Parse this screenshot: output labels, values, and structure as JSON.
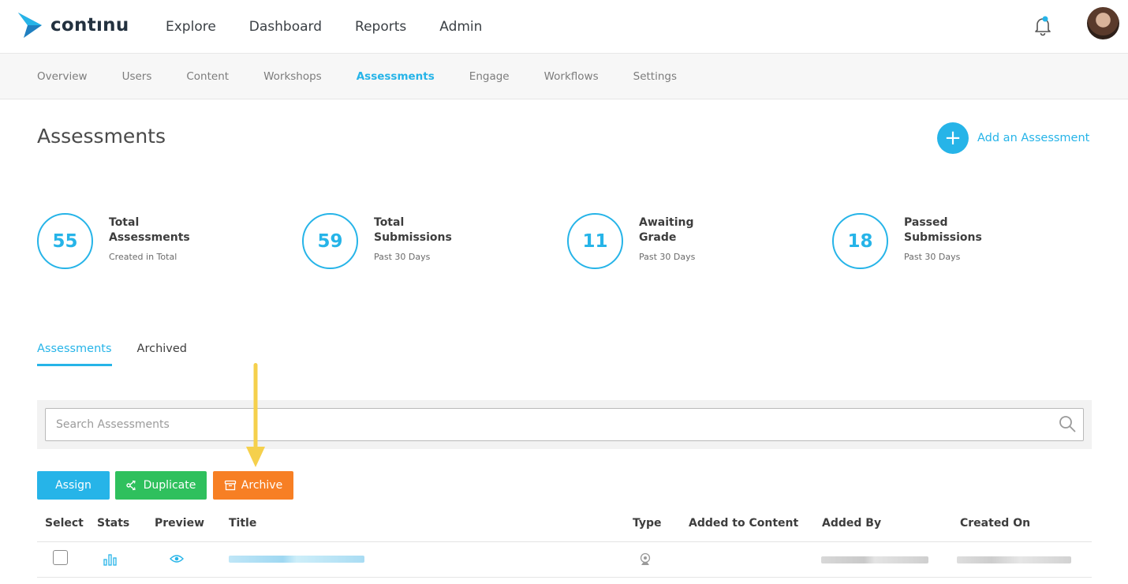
{
  "brand": {
    "name": "contınu"
  },
  "topnav": {
    "items": [
      "Explore",
      "Dashboard",
      "Reports",
      "Admin"
    ]
  },
  "subnav": {
    "items": [
      "Overview",
      "Users",
      "Content",
      "Workshops",
      "Assessments",
      "Engage",
      "Workflows",
      "Settings"
    ],
    "active": "Assessments"
  },
  "page": {
    "title": "Assessments",
    "add_label": "Add an Assessment",
    "add_symbol": "+"
  },
  "stats": [
    {
      "value": "55",
      "title": "Total Assessments",
      "sub": "Created in Total"
    },
    {
      "value": "59",
      "title": "Total Submissions",
      "sub": "Past 30 Days"
    },
    {
      "value": "11",
      "title": "Awaiting Grade",
      "sub": "Past 30 Days"
    },
    {
      "value": "18",
      "title": "Passed Submissions",
      "sub": "Past 30 Days"
    }
  ],
  "tabs": {
    "items": [
      "Assessments",
      "Archived"
    ],
    "active": "Assessments"
  },
  "search": {
    "placeholder": "Search Assessments",
    "value": ""
  },
  "actions": {
    "assign": "Assign",
    "duplicate": "Duplicate",
    "archive": "Archive"
  },
  "table": {
    "columns": [
      "Select",
      "Stats",
      "Preview",
      "Title",
      "Type",
      "Added to Content",
      "Added By",
      "Created On"
    ]
  },
  "colors": {
    "accent": "#26b4e8",
    "duplicate": "#2fc05d",
    "archive": "#f77f24",
    "annotation_arrow": "#f5d04c"
  }
}
